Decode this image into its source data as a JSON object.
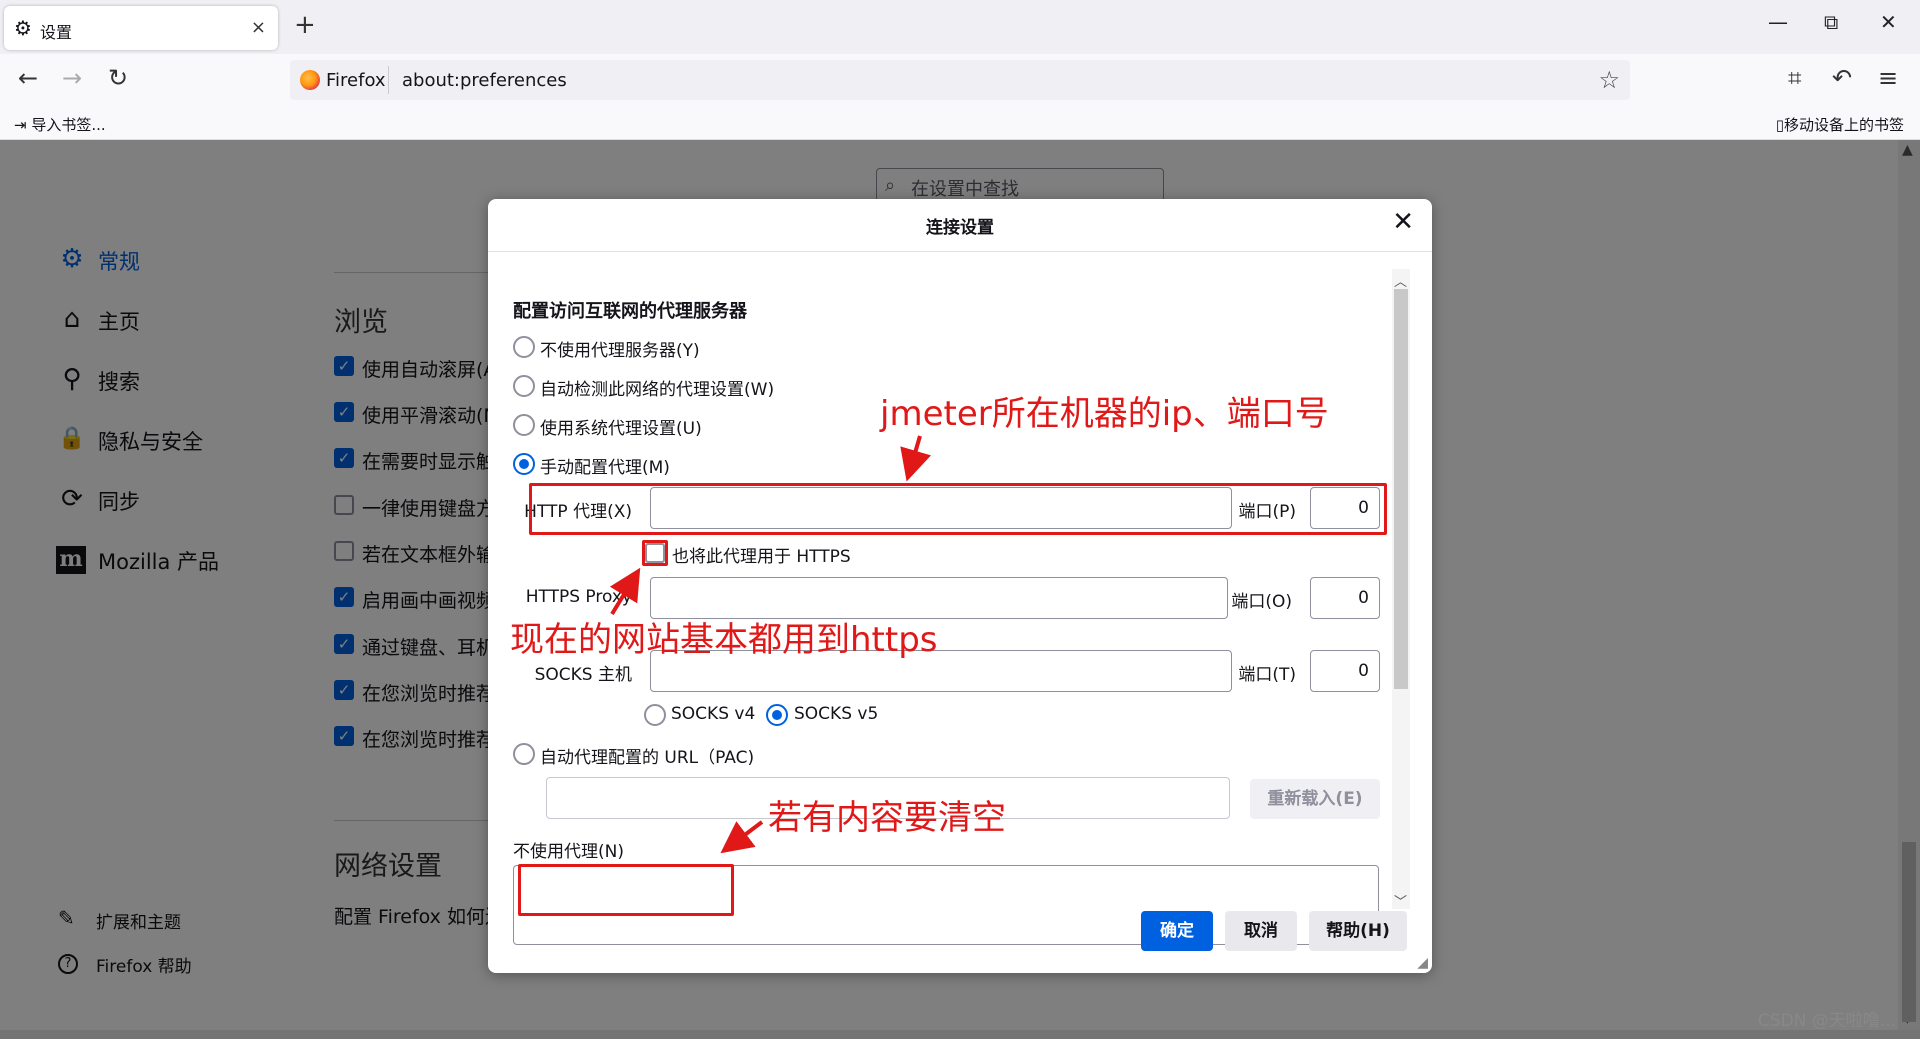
{
  "tab": {
    "title": "设置",
    "icon": "gear-icon",
    "close": "×"
  },
  "new_tab": "+",
  "window_controls": {
    "minimize": "—",
    "restore": "⧉",
    "close": "✕"
  },
  "nav": {
    "back": "←",
    "forward": "→",
    "reload": "↻"
  },
  "urlbar": {
    "identity": "Firefox",
    "url": "about:preferences",
    "star": "☆"
  },
  "toolbar_right": {
    "screenshot": "⌗",
    "undo": "↶",
    "menu": "≡"
  },
  "bookmarks": {
    "import": "导入书签...",
    "mobile": "移动设备上的书签"
  },
  "search": {
    "placeholder": "在设置中查找"
  },
  "sidebar": {
    "items": [
      {
        "label": "常规",
        "icon": "gear-icon",
        "glyph": "⚙"
      },
      {
        "label": "主页",
        "icon": "home-icon",
        "glyph": "⌂"
      },
      {
        "label": "搜索",
        "icon": "search-icon",
        "glyph": "⚲"
      },
      {
        "label": "隐私与安全",
        "icon": "lock-icon",
        "glyph": "🔒"
      },
      {
        "label": "同步",
        "icon": "sync-icon",
        "glyph": "⟳"
      },
      {
        "label": "Mozilla 产品",
        "icon": "mozilla-icon",
        "glyph": "m"
      }
    ],
    "bottom": [
      {
        "label": "扩展和主题",
        "icon": "puzzle-icon",
        "glyph": "✎"
      },
      {
        "label": "Firefox 帮助",
        "icon": "help-icon",
        "glyph": "?"
      }
    ]
  },
  "browsing": {
    "title": "浏览",
    "options": [
      {
        "label": "使用自动滚屏(A",
        "checked": true
      },
      {
        "label": "使用平滑滚动(M",
        "checked": true
      },
      {
        "label": "在需要时显示触",
        "checked": true
      },
      {
        "label": "一律使用键盘方",
        "checked": false
      },
      {
        "label": "若在文本框外输",
        "checked": false
      },
      {
        "label": "启用画中画视频",
        "checked": true
      },
      {
        "label": "通过键盘、耳机",
        "checked": true
      },
      {
        "label": "在您浏览时推荐",
        "checked": true
      },
      {
        "label": "在您浏览时推荐",
        "checked": true
      }
    ]
  },
  "network": {
    "title": "网络设置",
    "desc": "配置 Firefox 如何连"
  },
  "dialog": {
    "title": "连接设置",
    "close": "✕",
    "heading": "配置访问互联网的代理服务器",
    "radios": [
      {
        "label": "不使用代理服务器(Y)",
        "selected": false
      },
      {
        "label": "自动检测此网络的代理设置(W)",
        "selected": false
      },
      {
        "label": "使用系统代理设置(U)",
        "selected": false
      },
      {
        "label": "手动配置代理(M)",
        "selected": true
      }
    ],
    "http_label": "HTTP 代理(X)",
    "http_value": "",
    "http_port_label": "端口(P)",
    "http_port": "0",
    "also_https": "也将此代理用于 HTTPS",
    "https_label": "HTTPS Proxy",
    "https_port_label": "端口(O)",
    "https_port": "0",
    "socks_label": "SOCKS 主机",
    "socks_port_label": "端口(T)",
    "socks_port": "0",
    "socks_v4": "SOCKS v4",
    "socks_v5": "SOCKS v5",
    "socks_selected": "v5",
    "pac_label": "自动代理配置的 URL（PAC)",
    "reload": "重新载入(E)",
    "no_proxy_label": "不使用代理(N)",
    "ok": "确定",
    "cancel": "取消",
    "help": "帮助(H)"
  },
  "annotations": {
    "ip_port": "jmeter所在机器的ip、端口号",
    "https": "现在的网站基本都用到https",
    "clear": "若有内容要清空"
  },
  "watermark": "CSDN @天啦噜..."
}
